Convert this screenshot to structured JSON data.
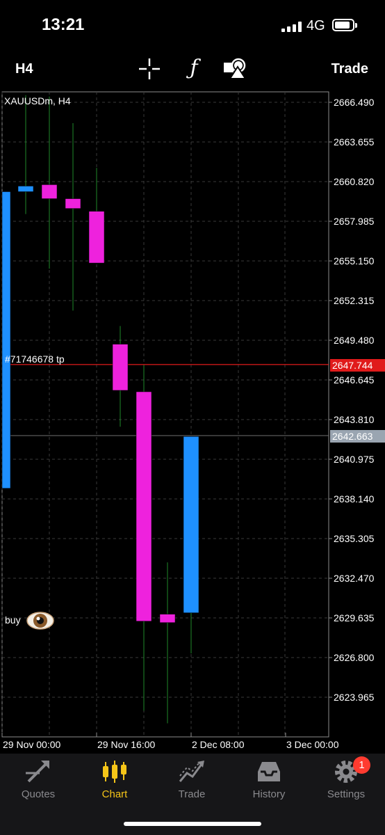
{
  "status": {
    "time": "13:21",
    "network": "4G"
  },
  "toolbar": {
    "timeframe": "H4",
    "trade_label": "Trade",
    "tools": [
      "crosshair-icon",
      "indicators-icon",
      "objects-icon"
    ]
  },
  "chart": {
    "symbol_label": "XAUUSDm, H4",
    "tp_label": "#71746678 tp",
    "tp_price": "2647.744",
    "current_price": "2642.663",
    "buy_label": "buy",
    "colors": {
      "bull": "#1e90ff",
      "bear": "#ee22dd",
      "wick": "#1f8a2a",
      "grid": "#3a3a3a",
      "tp_line": "#e01b1b"
    }
  },
  "chart_data": {
    "type": "candlestick",
    "title": "XAUUSDm, H4",
    "y_ticks": [
      "2666.490",
      "2663.655",
      "2660.820",
      "2657.985",
      "2655.150",
      "2652.315",
      "2649.480",
      "2646.645",
      "2643.810",
      "2640.975",
      "2638.140",
      "2635.305",
      "2632.470",
      "2629.635",
      "2626.800",
      "2623.965"
    ],
    "x_ticks": [
      "29 Nov 00:00",
      "29 Nov 16:00",
      "2 Dec 08:00",
      "3 Dec 00:00"
    ],
    "ylim": [
      2621.5,
      2667.5
    ],
    "candles": [
      {
        "open": 2638.9,
        "close": 2660.1,
        "high": 2660.1,
        "low": 2638.9
      },
      {
        "open": 2660.1,
        "close": 2660.5,
        "high": 2667.0,
        "low": 2658.5
      },
      {
        "open": 2660.6,
        "close": 2659.6,
        "high": 2666.9,
        "low": 2654.6
      },
      {
        "open": 2659.6,
        "close": 2658.9,
        "high": 2665.0,
        "low": 2651.6
      },
      {
        "open": 2658.7,
        "close": 2655.0,
        "high": 2661.8,
        "low": 2655.0
      },
      {
        "open": 2649.2,
        "close": 2645.9,
        "high": 2650.5,
        "low": 2643.3
      },
      {
        "open": 2645.8,
        "close": 2629.4,
        "high": 2647.7,
        "low": 2623.0
      },
      {
        "open": 2629.9,
        "close": 2629.3,
        "high": 2633.6,
        "low": 2622.1
      },
      {
        "open": 2630.0,
        "close": 2642.6,
        "high": 2642.6,
        "low": 2627.1
      }
    ],
    "lines": [
      {
        "name": "#71746678 tp",
        "value": 2647.744
      },
      {
        "name": "bid",
        "value": 2642.663
      }
    ]
  },
  "nav": {
    "items": [
      {
        "label": "Quotes",
        "icon": "quotes-icon"
      },
      {
        "label": "Chart",
        "icon": "chart-icon"
      },
      {
        "label": "Trade",
        "icon": "trade-icon"
      },
      {
        "label": "History",
        "icon": "history-icon"
      },
      {
        "label": "Settings",
        "icon": "settings-icon"
      }
    ],
    "settings_badge": "1"
  }
}
